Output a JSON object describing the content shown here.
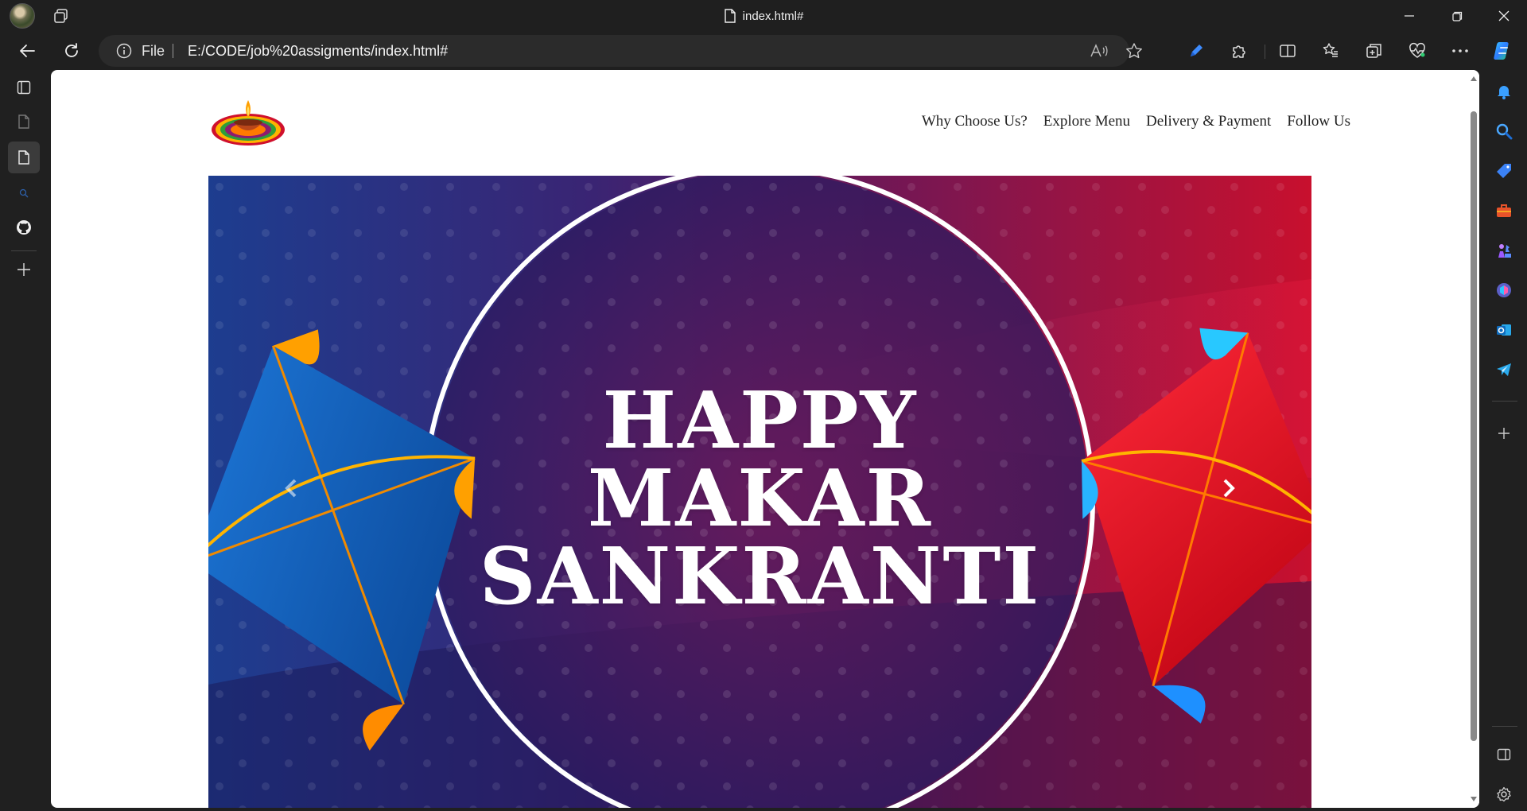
{
  "browser": {
    "tab_title": "index.html#",
    "address": {
      "scheme_label": "File",
      "url": "E:/CODE/job%20assigments/index.html#"
    },
    "icons": {
      "back": "back-arrow-icon",
      "reload": "reload-icon",
      "read_aloud": "read-aloud-icon",
      "favorite": "star-icon",
      "extensions": "puzzle-icon",
      "split_screen": "split-screen-icon",
      "favorites": "favorites-list-icon",
      "collections": "collections-icon",
      "performance": "heartbeat-icon",
      "more": "ellipsis-icon",
      "copilot": "copilot-icon"
    }
  },
  "left_tabs": [
    {
      "name": "tab-actions"
    },
    {
      "name": "tab-page-inactive"
    },
    {
      "name": "tab-page-active"
    },
    {
      "name": "tab-github"
    },
    {
      "name": "new-tab"
    }
  ],
  "right_sidebar": [
    "notification-bell-icon",
    "search-icon",
    "shopping-tag-icon",
    "tools-briefcase-icon",
    "games-chess-icon",
    "microsoft-365-icon",
    "outlook-icon",
    "telegram-send-icon",
    "add-icon",
    "sidebar-toggle-icon",
    "settings-gear-icon"
  ],
  "site": {
    "nav": [
      "Why Choose Us?",
      "Explore Menu",
      "Delivery & Payment",
      "Follow Us"
    ],
    "hero": {
      "line1": "HAPPY",
      "line2": "MAKAR",
      "line3": "SANKRANTI"
    },
    "colors": {
      "hero_left": "#2a2f8a",
      "hero_right": "#c8102e",
      "kite_blue": "#0b5fb3",
      "kite_red": "#e5101e",
      "accent_orange": "#ffa000"
    }
  }
}
